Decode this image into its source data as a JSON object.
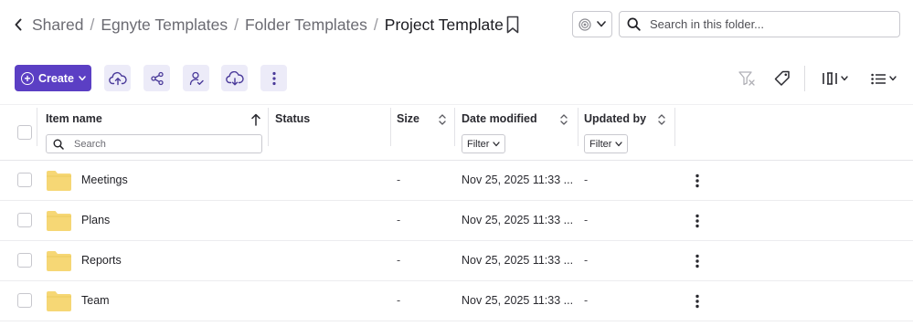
{
  "breadcrumb": {
    "items": [
      "Shared",
      "Egnyte Templates",
      "Folder Templates"
    ],
    "separator": "/",
    "current": "Project Template"
  },
  "search": {
    "placeholder": "Search in this folder..."
  },
  "toolbar": {
    "create_label": "Create",
    "buttons": [
      "upload-icon",
      "share-icon",
      "assign-user-icon",
      "download-icon",
      "more-icon"
    ],
    "right_icons": [
      "filter-clear-icon",
      "tag-icon",
      "columns-icon",
      "list-view-icon"
    ]
  },
  "table": {
    "columns": {
      "name": "Item name",
      "status": "Status",
      "size": "Size",
      "modified": "Date modified",
      "updated_by": "Updated by"
    },
    "name_filter_placeholder": "Search",
    "filter_label": "Filter",
    "rows": [
      {
        "name": "Meetings",
        "size": "-",
        "modified": "Nov 25, 2025 11:33 ...",
        "updated_by": "-"
      },
      {
        "name": "Plans",
        "size": "-",
        "modified": "Nov 25, 2025 11:33 ...",
        "updated_by": "-"
      },
      {
        "name": "Reports",
        "size": "-",
        "modified": "Nov 25, 2025 11:33 ...",
        "updated_by": "-"
      },
      {
        "name": "Team",
        "size": "-",
        "modified": "Nov 25, 2025 11:33 ...",
        "updated_by": "-"
      }
    ]
  },
  "colors": {
    "accent": "#5b3fc4",
    "toolbar_button_bg": "#ecebf8",
    "folder": "#f6d775"
  }
}
